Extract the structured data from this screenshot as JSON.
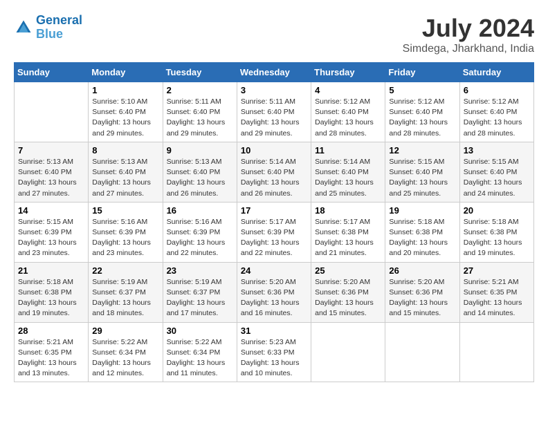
{
  "logo": {
    "line1": "General",
    "line2": "Blue"
  },
  "title": "July 2024",
  "subtitle": "Simdega, Jharkhand, India",
  "days_header": [
    "Sunday",
    "Monday",
    "Tuesday",
    "Wednesday",
    "Thursday",
    "Friday",
    "Saturday"
  ],
  "weeks": [
    [
      {
        "day": "",
        "detail": ""
      },
      {
        "day": "1",
        "detail": "Sunrise: 5:10 AM\nSunset: 6:40 PM\nDaylight: 13 hours\nand 29 minutes."
      },
      {
        "day": "2",
        "detail": "Sunrise: 5:11 AM\nSunset: 6:40 PM\nDaylight: 13 hours\nand 29 minutes."
      },
      {
        "day": "3",
        "detail": "Sunrise: 5:11 AM\nSunset: 6:40 PM\nDaylight: 13 hours\nand 29 minutes."
      },
      {
        "day": "4",
        "detail": "Sunrise: 5:12 AM\nSunset: 6:40 PM\nDaylight: 13 hours\nand 28 minutes."
      },
      {
        "day": "5",
        "detail": "Sunrise: 5:12 AM\nSunset: 6:40 PM\nDaylight: 13 hours\nand 28 minutes."
      },
      {
        "day": "6",
        "detail": "Sunrise: 5:12 AM\nSunset: 6:40 PM\nDaylight: 13 hours\nand 28 minutes."
      }
    ],
    [
      {
        "day": "7",
        "detail": "Sunrise: 5:13 AM\nSunset: 6:40 PM\nDaylight: 13 hours\nand 27 minutes."
      },
      {
        "day": "8",
        "detail": "Sunrise: 5:13 AM\nSunset: 6:40 PM\nDaylight: 13 hours\nand 27 minutes."
      },
      {
        "day": "9",
        "detail": "Sunrise: 5:13 AM\nSunset: 6:40 PM\nDaylight: 13 hours\nand 26 minutes."
      },
      {
        "day": "10",
        "detail": "Sunrise: 5:14 AM\nSunset: 6:40 PM\nDaylight: 13 hours\nand 26 minutes."
      },
      {
        "day": "11",
        "detail": "Sunrise: 5:14 AM\nSunset: 6:40 PM\nDaylight: 13 hours\nand 25 minutes."
      },
      {
        "day": "12",
        "detail": "Sunrise: 5:15 AM\nSunset: 6:40 PM\nDaylight: 13 hours\nand 25 minutes."
      },
      {
        "day": "13",
        "detail": "Sunrise: 5:15 AM\nSunset: 6:40 PM\nDaylight: 13 hours\nand 24 minutes."
      }
    ],
    [
      {
        "day": "14",
        "detail": "Sunrise: 5:15 AM\nSunset: 6:39 PM\nDaylight: 13 hours\nand 23 minutes."
      },
      {
        "day": "15",
        "detail": "Sunrise: 5:16 AM\nSunset: 6:39 PM\nDaylight: 13 hours\nand 23 minutes."
      },
      {
        "day": "16",
        "detail": "Sunrise: 5:16 AM\nSunset: 6:39 PM\nDaylight: 13 hours\nand 22 minutes."
      },
      {
        "day": "17",
        "detail": "Sunrise: 5:17 AM\nSunset: 6:39 PM\nDaylight: 13 hours\nand 22 minutes."
      },
      {
        "day": "18",
        "detail": "Sunrise: 5:17 AM\nSunset: 6:38 PM\nDaylight: 13 hours\nand 21 minutes."
      },
      {
        "day": "19",
        "detail": "Sunrise: 5:18 AM\nSunset: 6:38 PM\nDaylight: 13 hours\nand 20 minutes."
      },
      {
        "day": "20",
        "detail": "Sunrise: 5:18 AM\nSunset: 6:38 PM\nDaylight: 13 hours\nand 19 minutes."
      }
    ],
    [
      {
        "day": "21",
        "detail": "Sunrise: 5:18 AM\nSunset: 6:38 PM\nDaylight: 13 hours\nand 19 minutes."
      },
      {
        "day": "22",
        "detail": "Sunrise: 5:19 AM\nSunset: 6:37 PM\nDaylight: 13 hours\nand 18 minutes."
      },
      {
        "day": "23",
        "detail": "Sunrise: 5:19 AM\nSunset: 6:37 PM\nDaylight: 13 hours\nand 17 minutes."
      },
      {
        "day": "24",
        "detail": "Sunrise: 5:20 AM\nSunset: 6:36 PM\nDaylight: 13 hours\nand 16 minutes."
      },
      {
        "day": "25",
        "detail": "Sunrise: 5:20 AM\nSunset: 6:36 PM\nDaylight: 13 hours\nand 15 minutes."
      },
      {
        "day": "26",
        "detail": "Sunrise: 5:20 AM\nSunset: 6:36 PM\nDaylight: 13 hours\nand 15 minutes."
      },
      {
        "day": "27",
        "detail": "Sunrise: 5:21 AM\nSunset: 6:35 PM\nDaylight: 13 hours\nand 14 minutes."
      }
    ],
    [
      {
        "day": "28",
        "detail": "Sunrise: 5:21 AM\nSunset: 6:35 PM\nDaylight: 13 hours\nand 13 minutes."
      },
      {
        "day": "29",
        "detail": "Sunrise: 5:22 AM\nSunset: 6:34 PM\nDaylight: 13 hours\nand 12 minutes."
      },
      {
        "day": "30",
        "detail": "Sunrise: 5:22 AM\nSunset: 6:34 PM\nDaylight: 13 hours\nand 11 minutes."
      },
      {
        "day": "31",
        "detail": "Sunrise: 5:23 AM\nSunset: 6:33 PM\nDaylight: 13 hours\nand 10 minutes."
      },
      {
        "day": "",
        "detail": ""
      },
      {
        "day": "",
        "detail": ""
      },
      {
        "day": "",
        "detail": ""
      }
    ]
  ]
}
